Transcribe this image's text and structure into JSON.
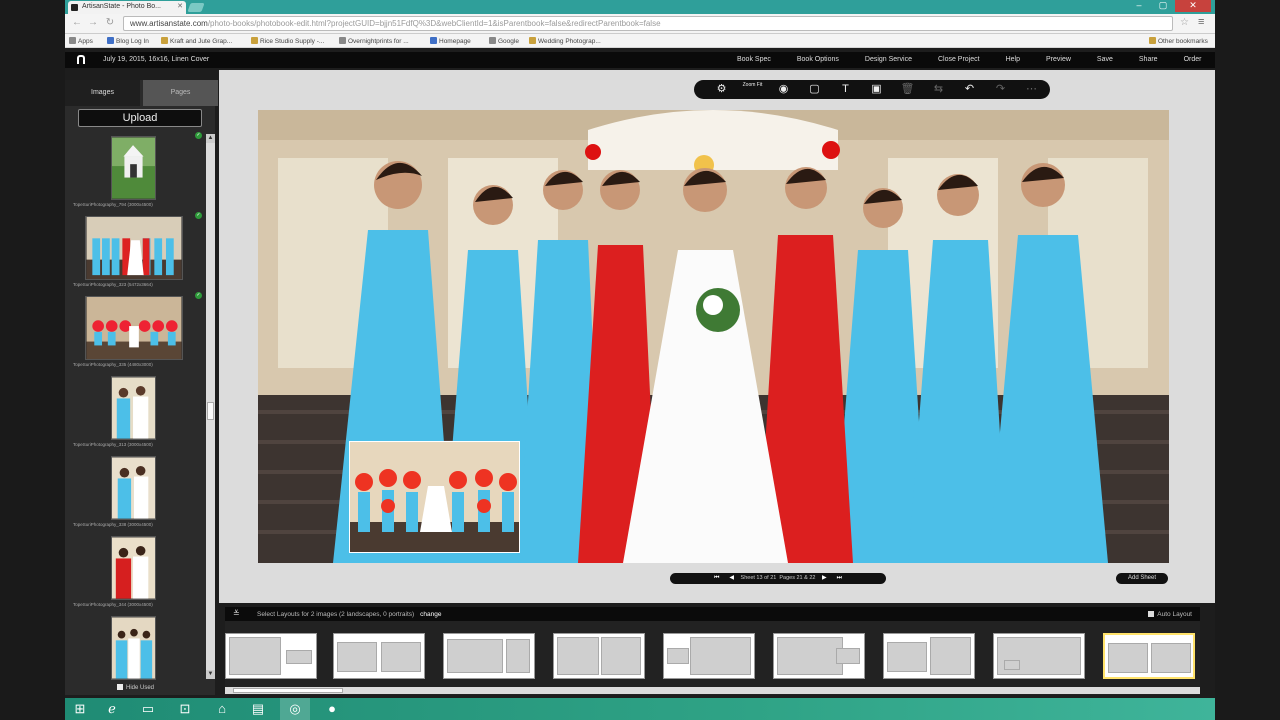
{
  "browser": {
    "tab_title": "ArtisanState - Photo Bo...",
    "url_domain": "www.artisanstate.com",
    "url_path": "/photo-books/photobook-edit.html?projectGUID=bjjn51FdfQ%3D&webClientId=1&isParentbook=false&redirectParentbook=false",
    "bookmarks": [
      "Apps",
      "Blog Log In",
      "Kraft and Jute Grap...",
      "Rice Studio Supply -...",
      "Overnightprints for ...",
      "Homepage",
      "Google",
      "Wedding Photograp...",
      "Other bookmarks"
    ]
  },
  "header": {
    "project": "July 19, 2015, 16x16, Linen Cover",
    "menu": [
      "Book Spec",
      "Book Options",
      "Design Service",
      "Close Project",
      "Help",
      "Preview",
      "Save",
      "Share",
      "Order"
    ]
  },
  "panel": {
    "tab_images": "Images",
    "tab_pages": "Pages",
    "upload": "Upload",
    "hide_used": "Hide Used",
    "thumbs": [
      {
        "caption": "TopeSuriPhotography_794 (3000x4500)"
      },
      {
        "caption": "TopeSuriPhotography_323 (5472x3664)"
      },
      {
        "caption": "TopeSuriPhotography_335 (4480x3000)"
      },
      {
        "caption": "TopeSuriPhotography_313 (3000x4500)"
      },
      {
        "caption": "TopeSuriPhotography_338 (3000x4500)"
      },
      {
        "caption": "TopeSuriPhotography_344 (3000x4500)"
      },
      {
        "caption": ""
      }
    ]
  },
  "toolbar": {
    "icons": [
      "gear-icon",
      "zoom-fit-icon",
      "eye-icon",
      "frame-icon",
      "text-icon",
      "image-tool-icon",
      "trash-icon",
      "swap-icon",
      "undo-icon",
      "redo-icon",
      "more-icon"
    ],
    "zoom_label": "Zoom Fit"
  },
  "pager": {
    "sheet": "Sheet 13 of 21",
    "pages": "Pages 21 & 22"
  },
  "add_sheet": "Add Sheet",
  "layouts": {
    "heading": "Select Layouts for 2 images (2 landscapes, 0 portraits)",
    "change": "change",
    "auto_layout": "Auto Layout"
  },
  "colors": {
    "dress_blue": "#4cbfe8",
    "dress_red": "#dc1f1f",
    "tab_strip": "#2f9f9a",
    "taskbar": "#2fa386"
  }
}
